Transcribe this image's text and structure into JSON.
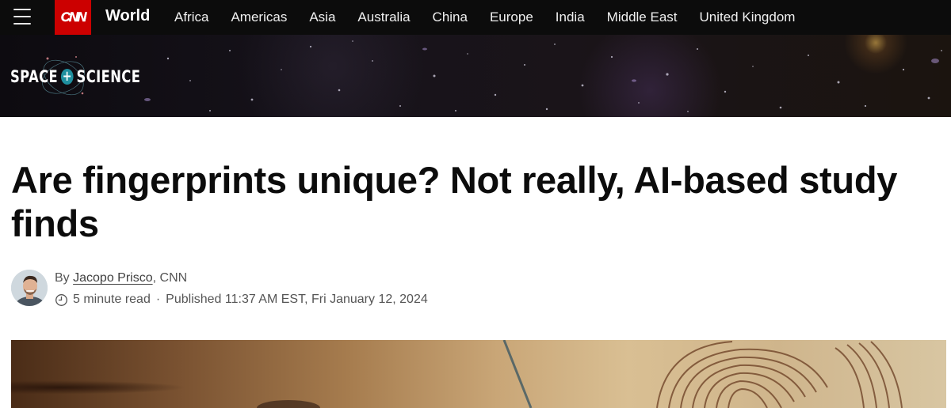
{
  "nav": {
    "menu_icon": "hamburger-menu-icon",
    "logo_text": "CNN",
    "brand_color": "#cc0000",
    "section": "World",
    "links": [
      "Africa",
      "Americas",
      "Asia",
      "Australia",
      "China",
      "Europe",
      "India",
      "Middle East",
      "United Kingdom"
    ]
  },
  "banner": {
    "section_left": "SPACE",
    "section_right": "SCIENCE",
    "plus_symbol": "+"
  },
  "article": {
    "headline": "Are fingerprints unique? Not really, AI-based study finds",
    "byline_prefix": "By ",
    "author": "Jacopo Prisco",
    "byline_suffix": ", CNN",
    "read_time": "5 minute read",
    "separator": "·",
    "published": "Published 11:37 AM EST, Fri January 12, 2024",
    "clock_icon": "clock-icon"
  }
}
